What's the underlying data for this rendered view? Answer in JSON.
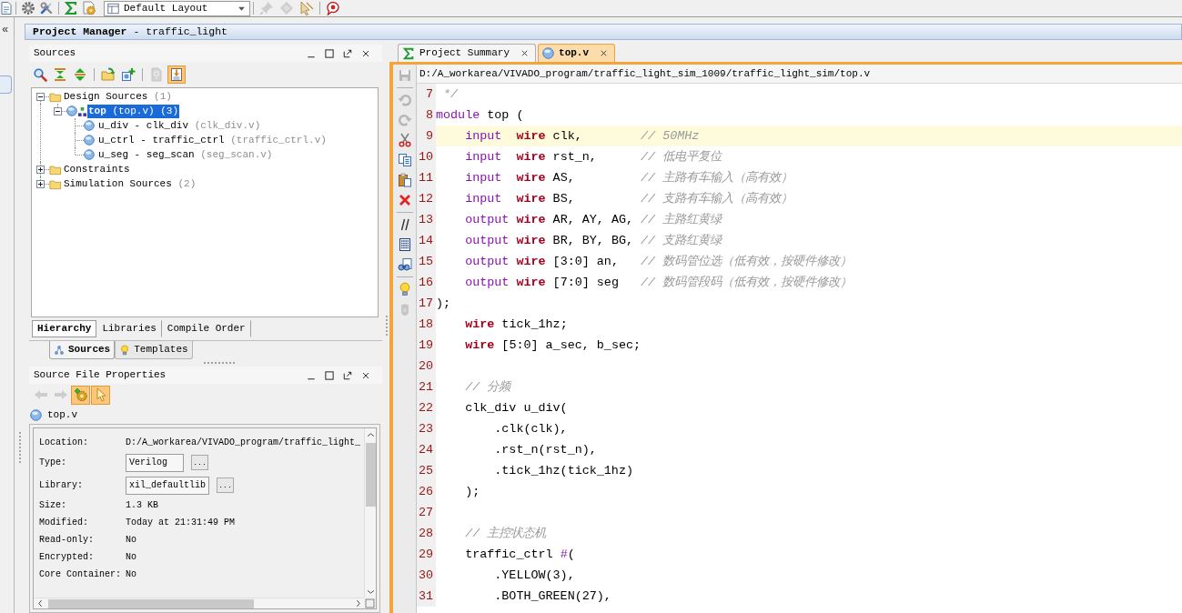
{
  "navigator": {
    "collapse": "«"
  },
  "toolbar": {
    "layout_select": {
      "value": "Default Layout"
    },
    "tools": [
      {
        "disabled": true
      },
      {
        "disabled": true
      },
      {
        "disabled": false
      },
      {
        "disabled": false
      }
    ]
  },
  "project_manager": {
    "title": "**Project Manager** - traffic_light"
  },
  "sources": {
    "title": "Sources",
    "toolbar": [
      {
        "disabled": false,
        "on": false
      },
      {
        "disabled": false,
        "on": false
      },
      {
        "disabled": false,
        "on": false
      },
      {
        "disabled": false,
        "on": false
      },
      {
        "disabled": false,
        "on": false
      },
      {
        "disabled": true,
        "on": false
      },
      {
        "disabled": false,
        "on": true
      }
    ],
    "tree": [
      {
        "kind": "folder",
        "label": "Design Sources",
        "count": "(1)",
        "expanded": true,
        "selected": false,
        "children": [
          {
            "kind": "top-module",
            "label": "top",
            "file": "(top.v)",
            "count": "(3)",
            "expanded": true,
            "selected": true,
            "children": [
              {
                "kind": "module",
                "label": "u_div - clk_div",
                "file": "(clk_div.v)",
                "selected": false
              },
              {
                "kind": "module",
                "label": "u_ctrl - traffic_ctrl",
                "file": "(traffic_ctrl.v)",
                "selected": false
              },
              {
                "kind": "module",
                "label": "u_seg - seg_scan",
                "file": "(seg_scan.v)",
                "selected": false
              }
            ]
          }
        ]
      },
      {
        "kind": "folder",
        "label": "Constraints",
        "expanded": false,
        "selected": false
      },
      {
        "kind": "folder",
        "label": "Simulation Sources",
        "count": "(2)",
        "expanded": false,
        "selected": false
      }
    ],
    "view_tabs": [
      {
        "label": "Hierarchy",
        "selected": true
      },
      {
        "label": "Libraries",
        "selected": false
      },
      {
        "label": "Compile Order",
        "selected": false
      }
    ]
  },
  "panel_tabs": [
    {
      "kind": "sources",
      "label": "Sources",
      "selected": true
    },
    {
      "kind": "templates",
      "label": "Templates",
      "selected": false
    }
  ],
  "properties": {
    "title": "Source File Properties",
    "toolbar": [
      {
        "disabled": true,
        "on": false
      },
      {
        "disabled": true,
        "on": false
      },
      {
        "disabled": false,
        "on": true
      },
      {
        "disabled": false,
        "on": true
      }
    ],
    "file": "top.v",
    "rows": [
      {
        "kind": "text",
        "label": "Location:",
        "value": "D:/A_workarea/VIVADO_program/traffic_light_"
      },
      {
        "kind": "field",
        "label": "Type:",
        "value": "Verilog",
        "button": "..."
      },
      {
        "kind": "field",
        "label": "Library:",
        "value": "xil_defaultlib",
        "button": "..."
      },
      {
        "kind": "text",
        "label": "Size:",
        "value": "1.3 KB"
      },
      {
        "kind": "text",
        "label": "Modified:",
        "value": "Today at 21:31:49 PM"
      },
      {
        "kind": "text",
        "label": "Read-only:",
        "value": "No"
      },
      {
        "kind": "text",
        "label": "Encrypted:",
        "value": "No"
      },
      {
        "kind": "text",
        "label": "Core Container:",
        "value": "No"
      }
    ]
  },
  "editor": {
    "tabs": [
      {
        "kind": "summary",
        "label": "Project Summary",
        "selected": false
      },
      {
        "kind": "source",
        "label": "top.v",
        "selected": true
      }
    ],
    "path": "D:/A_workarea/VIVADO_program/traffic_light_sim_1009/traffic_light_sim/top.v",
    "toolbar": [
      {
        "disabled": true
      },
      {
        "disabled": true
      },
      {
        "disabled": true
      },
      {
        "disabled": false
      },
      {
        "disabled": false
      },
      {
        "disabled": false
      },
      {
        "disabled": false
      },
      {
        "disabled": false
      },
      {
        "disabled": false
      },
      {
        "disabled": false
      },
      {
        "disabled": false
      },
      {
        "disabled": true
      }
    ],
    "lines": [
      {
        "number": "7",
        "current": false,
        "tokens": [
          {
            "kind": "comment",
            "text": " */"
          }
        ]
      },
      {
        "number": "8",
        "current": false,
        "tokens": [
          {
            "kind": "keyword",
            "text": "module"
          },
          {
            "kind": "text",
            "text": " top ("
          }
        ]
      },
      {
        "number": "9",
        "current": true,
        "tokens": [
          {
            "kind": "keyword",
            "text": "    input"
          },
          {
            "kind": "type",
            "text": "  wire"
          },
          {
            "kind": "text",
            "text": " clk,        "
          },
          {
            "kind": "comment",
            "text": "// 50MHz"
          }
        ]
      },
      {
        "number": "10",
        "current": false,
        "tokens": [
          {
            "kind": "keyword",
            "text": "    input"
          },
          {
            "kind": "type",
            "text": "  wire"
          },
          {
            "kind": "text",
            "text": " rst_n,      "
          },
          {
            "kind": "comment",
            "text": "// 低电平复位"
          }
        ]
      },
      {
        "number": "11",
        "current": false,
        "tokens": [
          {
            "kind": "keyword",
            "text": "    input"
          },
          {
            "kind": "type",
            "text": "  wire"
          },
          {
            "kind": "text",
            "text": " AS,         "
          },
          {
            "kind": "comment",
            "text": "// 主路有车输入（高有效）"
          }
        ]
      },
      {
        "number": "12",
        "current": false,
        "tokens": [
          {
            "kind": "keyword",
            "text": "    input"
          },
          {
            "kind": "type",
            "text": "  wire"
          },
          {
            "kind": "text",
            "text": " BS,         "
          },
          {
            "kind": "comment",
            "text": "// 支路有车输入（高有效）"
          }
        ]
      },
      {
        "number": "13",
        "current": false,
        "tokens": [
          {
            "kind": "keyword",
            "text": "    output"
          },
          {
            "kind": "type",
            "text": " wire"
          },
          {
            "kind": "text",
            "text": " AR, AY, AG, "
          },
          {
            "kind": "comment",
            "text": "// 主路红黄绿"
          }
        ]
      },
      {
        "number": "14",
        "current": false,
        "tokens": [
          {
            "kind": "keyword",
            "text": "    output"
          },
          {
            "kind": "type",
            "text": " wire"
          },
          {
            "kind": "text",
            "text": " BR, BY, BG, "
          },
          {
            "kind": "comment",
            "text": "// 支路红黄绿"
          }
        ]
      },
      {
        "number": "15",
        "current": false,
        "tokens": [
          {
            "kind": "keyword",
            "text": "    output"
          },
          {
            "kind": "type",
            "text": " wire"
          },
          {
            "kind": "text",
            "text": " [3:0] an,   "
          },
          {
            "kind": "comment",
            "text": "// 数码管位选（低有效，按硬件修改）"
          }
        ]
      },
      {
        "number": "16",
        "current": false,
        "tokens": [
          {
            "kind": "keyword",
            "text": "    output"
          },
          {
            "kind": "type",
            "text": " wire"
          },
          {
            "kind": "text",
            "text": " [7:0] seg   "
          },
          {
            "kind": "comment",
            "text": "// 数码管段码（低有效，按硬件修改）"
          }
        ]
      },
      {
        "number": "17",
        "current": false,
        "tokens": [
          {
            "kind": "text",
            "text": ");"
          }
        ]
      },
      {
        "number": "18",
        "current": false,
        "tokens": [
          {
            "kind": "type",
            "text": "    wire"
          },
          {
            "kind": "text",
            "text": " tick_1hz;"
          }
        ]
      },
      {
        "number": "19",
        "current": false,
        "tokens": [
          {
            "kind": "type",
            "text": "    wire"
          },
          {
            "kind": "text",
            "text": " [5:0] a_sec, b_sec;"
          }
        ]
      },
      {
        "number": "20",
        "current": false
      },
      {
        "number": "21",
        "current": false,
        "tokens": [
          {
            "kind": "comment",
            "text": "    // 分频"
          }
        ]
      },
      {
        "number": "22",
        "current": false,
        "tokens": [
          {
            "kind": "text",
            "text": "    clk_div u_div("
          }
        ]
      },
      {
        "number": "23",
        "current": false,
        "tokens": [
          {
            "kind": "text",
            "text": "        .clk(clk),"
          }
        ]
      },
      {
        "number": "24",
        "current": false,
        "tokens": [
          {
            "kind": "text",
            "text": "        .rst_n(rst_n),"
          }
        ]
      },
      {
        "number": "25",
        "current": false,
        "tokens": [
          {
            "kind": "text",
            "text": "        .tick_1hz(tick_1hz)"
          }
        ]
      },
      {
        "number": "26",
        "current": false,
        "tokens": [
          {
            "kind": "text",
            "text": "    );"
          }
        ]
      },
      {
        "number": "27",
        "current": false
      },
      {
        "number": "28",
        "current": false,
        "tokens": [
          {
            "kind": "comment",
            "text": "    // 主控状态机"
          }
        ]
      },
      {
        "number": "29",
        "current": false,
        "tokens": [
          {
            "kind": "text",
            "text": "    traffic_ctrl "
          },
          {
            "kind": "keyword",
            "text": "#"
          },
          {
            "kind": "text",
            "text": "("
          }
        ]
      },
      {
        "number": "30",
        "current": false,
        "tokens": [
          {
            "kind": "text",
            "text": "        .YELLOW(3),"
          }
        ]
      },
      {
        "number": "31",
        "current": false,
        "tokens": [
          {
            "kind": "text",
            "text": "        .BOTH_GREEN(27),"
          }
        ]
      }
    ]
  }
}
